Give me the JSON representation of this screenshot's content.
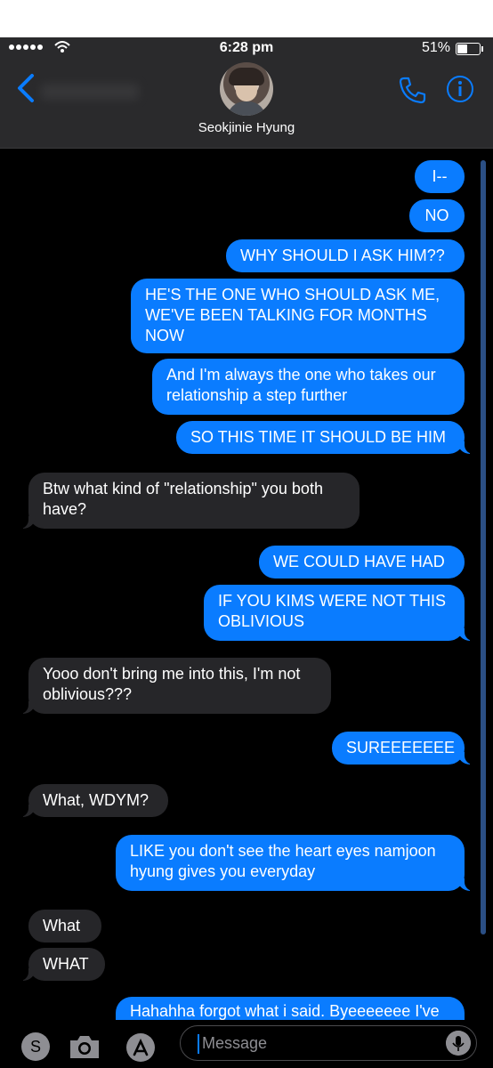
{
  "status_bar": {
    "time": "6:28 pm",
    "battery": "51%",
    "battery_level": 0.51
  },
  "header": {
    "contact_name": "Seokjinie Hyung"
  },
  "messages": [
    {
      "side": "sent",
      "text": "I--"
    },
    {
      "side": "sent",
      "text": "NO"
    },
    {
      "side": "sent",
      "text": "WHY SHOULD I ASK HIM??"
    },
    {
      "side": "sent",
      "text": "HE'S THE ONE WHO SHOULD ASK ME, WE'VE BEEN TALKING FOR MONTHS NOW"
    },
    {
      "side": "sent",
      "text": "And I'm always the one who takes our relationship a step further"
    },
    {
      "side": "sent",
      "text": "SO THIS TIME IT SHOULD BE HIM"
    },
    {
      "side": "received",
      "text": "Btw what kind of \"relationship\" you both have?"
    },
    {
      "side": "sent",
      "text": "WE COULD HAVE HAD"
    },
    {
      "side": "sent",
      "text": "IF YOU KIMS WERE NOT THIS OBLIVIOUS"
    },
    {
      "side": "received",
      "text": "Yooo don't bring me into this, I'm not oblivious???"
    },
    {
      "side": "sent",
      "text": "SUREEEEEEE"
    },
    {
      "side": "received",
      "text": "What, WDYM?"
    },
    {
      "side": "sent",
      "text": "LIKE you don't see the heart eyes namjoon hyung gives you everyday"
    },
    {
      "side": "received",
      "text": "What"
    },
    {
      "side": "received",
      "text": "WHAT"
    },
    {
      "side": "sent",
      "text": "Hahahha forgot what i said. Byeeeeeee I've"
    }
  ],
  "composer": {
    "placeholder": "Message",
    "s_label": "S"
  },
  "colors": {
    "sent": "#0a7cff",
    "received": "#262629",
    "header": "#2a2a2c"
  },
  "icons": [
    "back-chevron-icon",
    "phone-icon",
    "info-icon",
    "camera-icon",
    "app-store-icon",
    "microphone-icon",
    "wifi-icon"
  ]
}
